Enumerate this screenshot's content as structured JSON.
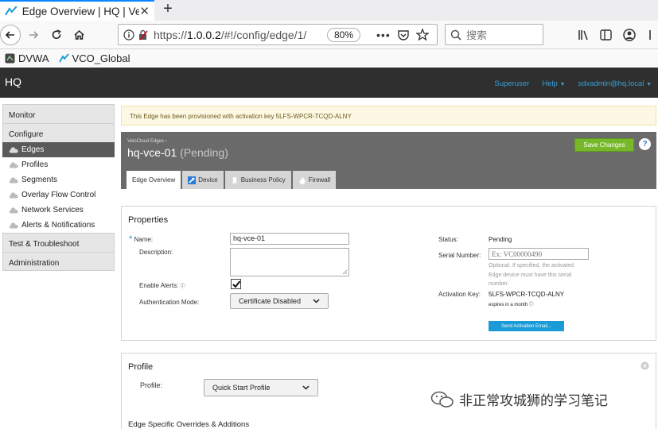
{
  "browser": {
    "tab_title": "Edge Overview | HQ | Ve",
    "url_prefix": "https://",
    "url_host": "1.0.0.2",
    "url_path": "/#!/config/edge/1/",
    "zoom": "80%",
    "search_placeholder": "搜索",
    "bookmarks": [
      {
        "label": "DVWA"
      },
      {
        "label": "VCO_Global"
      }
    ]
  },
  "header": {
    "brand": "HQ",
    "superuser": "Superuser",
    "help": "Help",
    "user": "sdxadmin@hq.local"
  },
  "sidebar": {
    "monitor": "Monitor",
    "configure": "Configure",
    "items": [
      {
        "label": "Edges"
      },
      {
        "label": "Profiles"
      },
      {
        "label": "Segments"
      },
      {
        "label": "Overlay Flow Control"
      },
      {
        "label": "Network Services"
      },
      {
        "label": "Alerts & Notifications"
      }
    ],
    "test": "Test & Troubleshoot",
    "admin": "Administration"
  },
  "alert": "This Edge has been provisioned with activation key 5LFS-WPCR-TCQD-ALNY",
  "page": {
    "breadcrumb": "VeloCloud Edges",
    "edge_name": "hq-vce-01",
    "state": "(Pending)",
    "save": "Save Changes",
    "help": "?",
    "tabs": [
      {
        "label": "Edge Overview"
      },
      {
        "label": "Device"
      },
      {
        "label": "Business Policy"
      },
      {
        "label": "Firewall"
      }
    ]
  },
  "properties": {
    "title": "Properties",
    "name_label": "Name:",
    "name_value": "hq-vce-01",
    "desc_label": "Description:",
    "alerts_label": "Enable Alerts:",
    "auth_label": "Authentication Mode:",
    "auth_value": "Certificate Disabled",
    "status_label": "Status:",
    "status_value": "Pending",
    "serial_label": "Serial Number:",
    "serial_placeholder": "Ex: VC00000490",
    "serial_note": "Optional. If specified, the activated Edge device must have this serial number.",
    "key_label": "Activation Key:",
    "key_value": "5LFS-WPCR-TCQD-ALNY",
    "key_note": "expires in a month",
    "send_btn": "Send Activation Email..."
  },
  "profile": {
    "title": "Profile",
    "profile_label": "Profile:",
    "profile_value": "Quick Start Profile",
    "overrides": "Edge Specific Overrides & Additions"
  },
  "watermark": "非正常攻城狮的学习笔记"
}
